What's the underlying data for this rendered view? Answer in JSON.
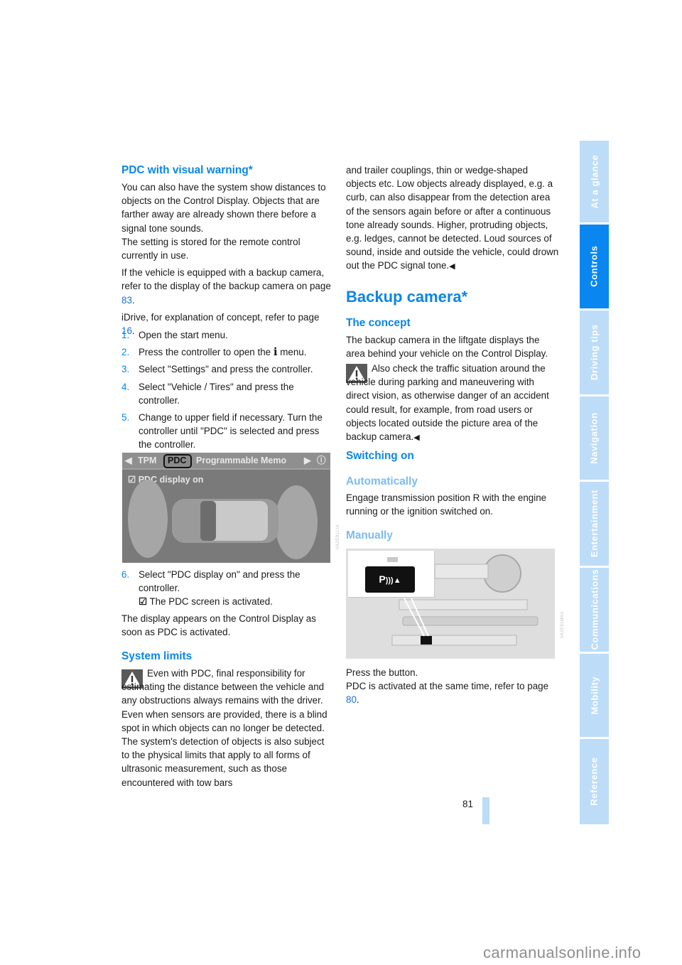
{
  "left_column": {
    "pdc_heading": "PDC with visual warning*",
    "intro_p1": "You can also have the system show distances to objects on the Control Display. Objects that are farther away are already shown there before a signal tone sounds.",
    "intro_p1b": "The setting is stored for the remote control currently in use.",
    "intro_p2_pre": "If the vehicle is equipped with a backup camera, refer to the display of the backup camera on page ",
    "intro_p2_link": "83",
    "intro_p3_pre": "iDrive, for explanation of concept, refer to page ",
    "intro_p3_link": "16",
    "steps": [
      {
        "num": "1.",
        "text": "Open the start menu."
      },
      {
        "num": "2.",
        "text_pre": "Press the controller to open the ",
        "icon": "i",
        "text_post": " menu."
      },
      {
        "num": "3.",
        "text": "Select \"Settings\" and press the controller."
      },
      {
        "num": "4.",
        "text": "Select \"Vehicle / Tires\" and press the controller."
      },
      {
        "num": "5.",
        "text": "Change to upper field if necessary. Turn the controller until \"PDC\" is selected and press the controller."
      }
    ],
    "screen": {
      "tabs": [
        "TPM",
        "PDC",
        "Programmable Memo"
      ],
      "selected_tab": "PDC",
      "option": "PDC display on",
      "image_code": "VA2E91LIA"
    },
    "step6": {
      "num": "6.",
      "text": "Select \"PDC display on\" and press the controller.",
      "result": "The PDC screen is activated."
    },
    "after_steps": "The display appears on the Control Display as soon as PDC is activated.",
    "system_limits_heading": "System limits",
    "limits_text": "Even with PDC, final responsibility for estimating the distance between the vehicle and any obstructions always remains with the driver. Even when sensors are provided, there is a blind spot in which objects can no longer be detected. The system's detection of objects is also subject to the physical limits that apply to all forms of ultrasonic measurement, such as those encountered with tow bars"
  },
  "right_column": {
    "limits_cont": "and trailer couplings, thin or wedge-shaped objects etc. Low objects already displayed, e.g. a curb, can also disappear from the detection area of the sensors again before or after a continuous tone already sounds. Higher, protruding objects, e.g. ledges, cannot be detected. Loud sources of sound, inside and outside the vehicle, could drown out the PDC signal tone.",
    "end_mark": "◀",
    "backup_heading": "Backup camera*",
    "concept_heading": "The concept",
    "concept_text": "The backup camera in the liftgate displays the area behind your vehicle on the Control Display.",
    "concept_warning": "Also check the traffic situation around the vehicle during parking and maneuvering with direct vision, as otherwise danger of an accident could result, for example, from road users or objects located outside the picture area of the backup camera.",
    "switching_heading": "Switching on",
    "auto_heading": "Automatically",
    "auto_text": "Engage transmission position R with the engine running or the ignition switched on.",
    "manual_heading": "Manually",
    "console_image": {
      "button_label": "P",
      "image_code": "VA2E91M0A"
    },
    "press_text": "Press the button.",
    "pdc_ref_pre": "PDC is activated at the same time, refer to page ",
    "pdc_ref_link": "80"
  },
  "sidebar": {
    "tabs": [
      {
        "label": "At a glance",
        "active": false
      },
      {
        "label": "Controls",
        "active": true
      },
      {
        "label": "Driving tips",
        "active": false
      },
      {
        "label": "Navigation",
        "active": false
      },
      {
        "label": "Entertainment",
        "active": false
      },
      {
        "label": "Communications",
        "active": false
      },
      {
        "label": "Mobility",
        "active": false
      },
      {
        "label": "Reference",
        "active": false
      }
    ],
    "active_color": "#0a86f0",
    "inactive_color": "#bddcf8"
  },
  "footer": {
    "page_number": "81",
    "watermark": "carmanualsonline.info"
  }
}
